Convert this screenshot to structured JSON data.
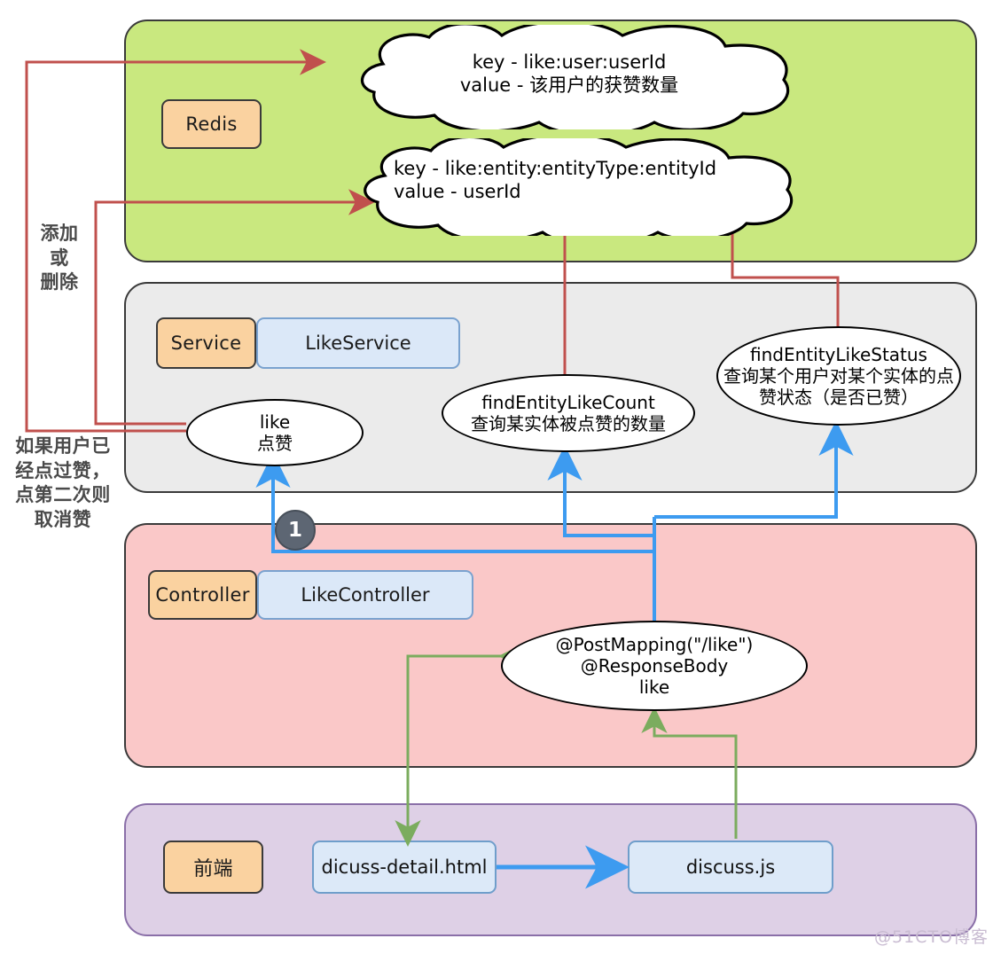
{
  "title": "Like feature architecture diagram (Redis / Service / Controller / Frontend)",
  "layers": {
    "redis": {
      "tag": "Redis",
      "clouds": [
        {
          "line1": "key - like:user:userId",
          "line2": "value - 该用户的获赞数量"
        },
        {
          "line1": "key - like:entity:entityType:entityId",
          "line2": "value - userId"
        }
      ]
    },
    "service": {
      "tag": "Service",
      "class_name": "LikeService",
      "methods": [
        {
          "name": "like",
          "desc": "点赞",
          "desc2": ""
        },
        {
          "name": "findEntityLikeCount",
          "desc": "查询某实体被点赞的数量",
          "desc2": ""
        },
        {
          "name": "findEntityLikeStatus",
          "desc": "查询某个用户对某个实体的点",
          "desc2": "赞状态（是否已赞）"
        }
      ]
    },
    "controller": {
      "tag": "Controller",
      "class_name": "LikeController",
      "endpoint": {
        "line1": "@PostMapping(\"/like\")",
        "line2": "@ResponseBody",
        "line3": "like"
      }
    },
    "frontend": {
      "tag": "前端",
      "files": [
        {
          "name": "dicuss-detail.html"
        },
        {
          "name": "discuss.js"
        }
      ]
    }
  },
  "notes": [
    {
      "id": "add-or-delete",
      "text": "添加\n或\n删除"
    },
    {
      "id": "toggle-like",
      "text": "如果用户已\n经点过赞，\n点第二次则\n取消赞"
    }
  ],
  "badges": [
    {
      "label": "1"
    }
  ],
  "watermark": "@51CTO博客",
  "colors": {
    "redis_panel": "#c9e87f",
    "service_panel": "#ebebeb",
    "controller_panel": "#fac8c8",
    "frontend_panel": "#ded0e6",
    "tag_orange": "#fad2a0",
    "class_blue": "#dbe8f8",
    "arrow_red": "#c0504d",
    "arrow_blue": "#3d9bf0",
    "arrow_green": "#7bac5e",
    "badge_gray": "#5d6673"
  }
}
